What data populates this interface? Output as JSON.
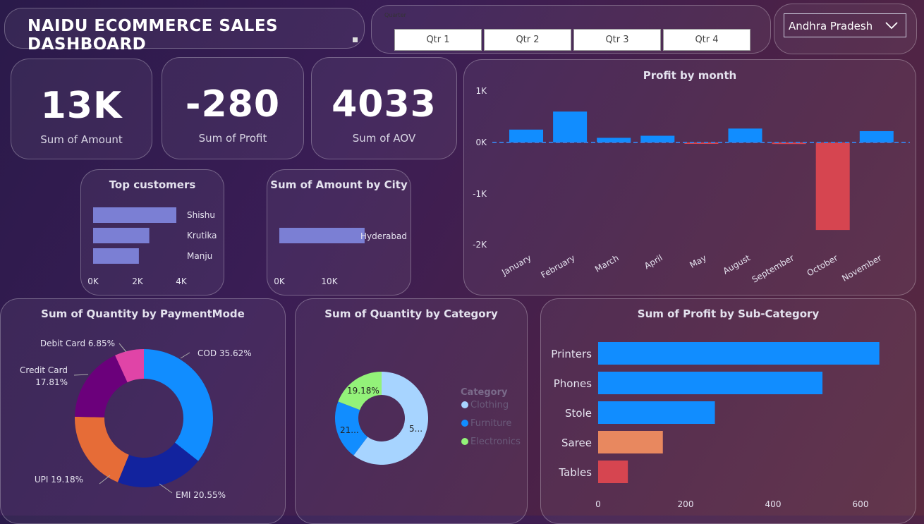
{
  "header": {
    "title": "NAIDU ECOMMERCE SALES DASHBOARD"
  },
  "quarter_slicer": {
    "label": "Quarter",
    "options": [
      "Qtr 1",
      "Qtr 2",
      "Qtr 3",
      "Qtr 4"
    ]
  },
  "state_select": {
    "value": "Andhra Pradesh"
  },
  "kpis": [
    {
      "value": "13K",
      "label": "Sum of Amount"
    },
    {
      "value": "-280",
      "label": "Sum of Profit"
    },
    {
      "value": "4033",
      "label": "Sum of AOV"
    }
  ],
  "colors": {
    "blue": "#118dff",
    "red": "#d64550",
    "purple_bar": "#7b7fd4",
    "orange": "#e8885f",
    "green": "#93f279",
    "light_blue": "#a7d4ff"
  },
  "chart_data": [
    {
      "title": "Top customers",
      "type": "bar",
      "orientation": "horizontal",
      "categories": [
        "Shishu",
        "Krutika",
        "Manju"
      ],
      "values": [
        4000,
        2700,
        2200
      ],
      "ticks": [
        "0K",
        "2K",
        "4K"
      ],
      "xlim": [
        0,
        4000
      ]
    },
    {
      "title": "Sum of Amount by City",
      "type": "bar",
      "orientation": "horizontal",
      "categories": [
        "Hyderabad"
      ],
      "values": [
        13000
      ],
      "ticks": [
        "0K",
        "10K"
      ],
      "xlim": [
        0,
        20000
      ]
    },
    {
      "title": "Profit by month",
      "type": "bar",
      "categories": [
        "January",
        "February",
        "March",
        "April",
        "May",
        "August",
        "September",
        "October",
        "November"
      ],
      "values": [
        250,
        600,
        90,
        130,
        -10,
        270,
        -30,
        -1700,
        220
      ],
      "ticks": [
        "1K",
        "0K",
        "-1K",
        "-2K"
      ],
      "ylim": [
        -2000,
        1000
      ]
    },
    {
      "title": "Sum of Quantity by PaymentMode",
      "type": "pie",
      "donut": true,
      "labels": [
        "COD",
        "EMI",
        "UPI",
        "Credit Card",
        "Debit Card"
      ],
      "values": [
        35.62,
        20.55,
        19.18,
        17.81,
        6.85
      ],
      "display_labels": [
        "COD 35.62%",
        "EMI 20.55%",
        "UPI 19.18%",
        "Credit Card",
        "17.81%",
        "Debit Card 6.85%"
      ],
      "colors": [
        "#118dff",
        "#12239e",
        "#e66c37",
        "#6b007b",
        "#e044a7"
      ]
    },
    {
      "title": "Sum of Quantity by Category",
      "type": "pie",
      "donut": true,
      "labels": [
        "Clothing",
        "Furniture",
        "Electronics"
      ],
      "values": [
        60.27,
        20.55,
        19.18
      ],
      "display_labels": [
        "5...",
        "21...",
        "19.18%"
      ],
      "legend_title": "Category",
      "colors": [
        "#a7d4ff",
        "#118dff",
        "#93f279"
      ]
    },
    {
      "title": "Sum of Profit by Sub-Category",
      "type": "bar",
      "orientation": "horizontal",
      "categories": [
        "Printers",
        "Phones",
        "Stole",
        "Saree",
        "Tables"
      ],
      "values": [
        643,
        513,
        267,
        148,
        68
      ],
      "ticks": [
        "0",
        "200",
        "400",
        "600"
      ],
      "xlim": [
        0,
        700
      ]
    }
  ]
}
